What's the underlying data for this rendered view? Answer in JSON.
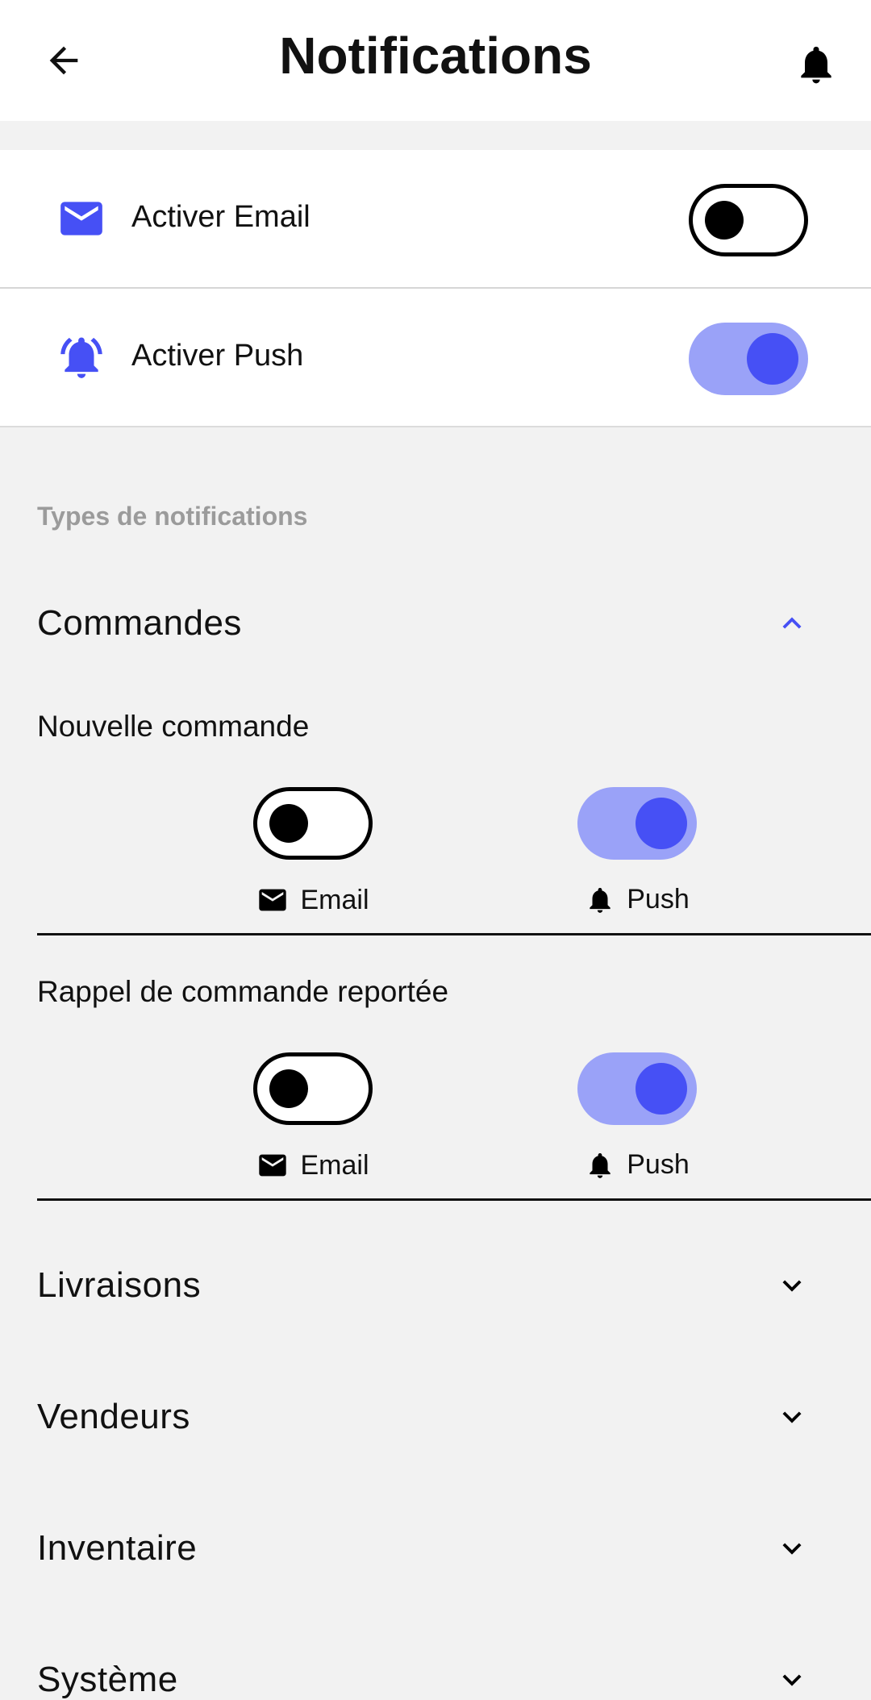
{
  "header": {
    "title": "Notifications"
  },
  "global": {
    "email_label": "Activer Email",
    "push_label": "Activer Push",
    "email_enabled": false,
    "push_enabled": true
  },
  "section": {
    "title": "Types de notifications"
  },
  "groups": [
    {
      "title": "Commandes",
      "expanded": true
    },
    {
      "title": "Livraisons",
      "expanded": false
    },
    {
      "title": "Vendeurs",
      "expanded": false
    },
    {
      "title": "Inventaire",
      "expanded": false
    },
    {
      "title": "Système",
      "expanded": false
    }
  ],
  "items": [
    {
      "name": "Nouvelle commande",
      "email_label": "Email",
      "push_label": "Push",
      "email_enabled": false,
      "push_enabled": true
    },
    {
      "name": "Rappel de commande reportée",
      "email_label": "Email",
      "push_label": "Push",
      "email_enabled": false,
      "push_enabled": true
    }
  ],
  "colors": {
    "accent": "#4650f5",
    "accent_light": "#9aa2f8",
    "background": "#f2f2f2",
    "muted": "#9b9b9b"
  },
  "icons": [
    "back-arrow-icon",
    "bell-icon",
    "mail-icon",
    "bell-ringing-icon",
    "chevron-up-icon",
    "chevron-down-icon"
  ]
}
